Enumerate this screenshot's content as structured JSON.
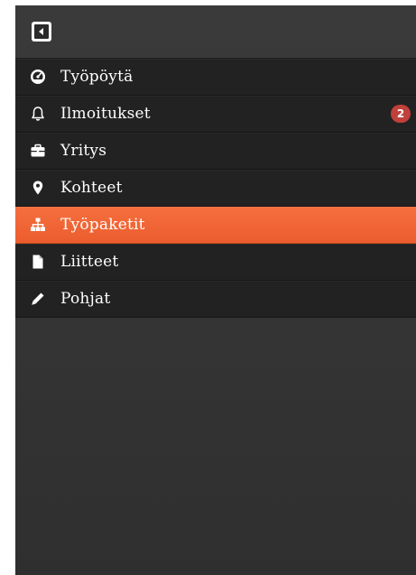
{
  "sidebar": {
    "collapse_button_icon": "caret-left-square-icon",
    "items": [
      {
        "label": "Työpöytä",
        "icon": "dashboard-icon",
        "active": false
      },
      {
        "label": "Ilmoitukset",
        "icon": "bell-icon",
        "active": false,
        "badge": "2"
      },
      {
        "label": "Yritys",
        "icon": "briefcase-icon",
        "active": false
      },
      {
        "label": "Kohteet",
        "icon": "map-marker-icon",
        "active": false
      },
      {
        "label": "Työpaketit",
        "icon": "sitemap-icon",
        "active": true
      },
      {
        "label": "Liitteet",
        "icon": "file-icon",
        "active": false
      },
      {
        "label": "Pohjat",
        "icon": "pencil-icon",
        "active": false
      }
    ]
  },
  "colors": {
    "active_item": "#ef6533",
    "item_background": "#222222",
    "sidebar_background": "#363636",
    "badge": "#c0403a"
  }
}
